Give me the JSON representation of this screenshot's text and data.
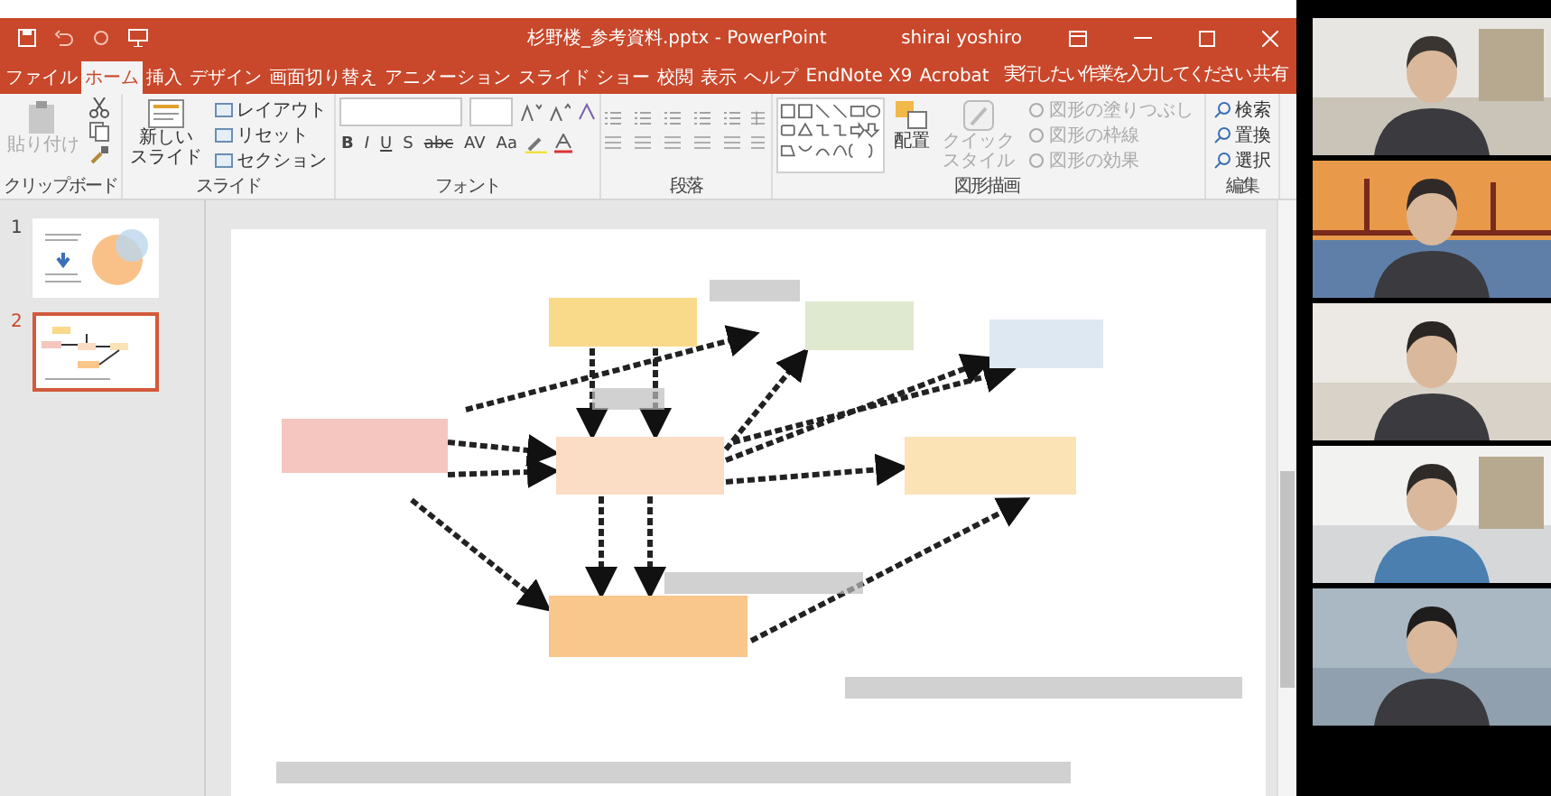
{
  "window": {
    "title": "杉野楼_参考資料.pptx  -  PowerPoint",
    "user": "shirai yoshiro"
  },
  "tabs": [
    {
      "label": "ファイル",
      "selected": false
    },
    {
      "label": "ホーム",
      "selected": true
    },
    {
      "label": "挿入",
      "selected": false
    },
    {
      "label": "デザイン",
      "selected": false
    },
    {
      "label": "画面切り替え",
      "selected": false
    },
    {
      "label": "アニメーション",
      "selected": false
    },
    {
      "label": "スライド ショー",
      "selected": false
    },
    {
      "label": "校閲",
      "selected": false
    },
    {
      "label": "表示",
      "selected": false
    },
    {
      "label": "ヘルプ",
      "selected": false
    },
    {
      "label": "EndNote X9",
      "selected": false
    },
    {
      "label": "Acrobat",
      "selected": false
    }
  ],
  "tell_me": "実行したい作業を入力してください",
  "share": "共有",
  "ribbon": {
    "clipboard": {
      "label": "クリップボード",
      "paste": "貼り付け"
    },
    "slides": {
      "label": "スライド",
      "new_slide": [
        "新しい",
        "スライド"
      ],
      "items": [
        "レイアウト",
        "リセット",
        "セクション"
      ]
    },
    "font": {
      "label": "フォント",
      "buttons": [
        "B",
        "I",
        "U",
        "S",
        "abc",
        "AV",
        "Aa"
      ]
    },
    "paragraph": {
      "label": "段落"
    },
    "drawing": {
      "label": "図形描画",
      "arrange": "配置",
      "quick_style": [
        "クイック",
        "スタイル"
      ],
      "items": [
        "図形の塗りつぶし",
        "図形の枠線",
        "図形の効果"
      ]
    },
    "editing": {
      "label": "編集",
      "items": [
        "検索",
        "置換",
        "選択"
      ]
    }
  },
  "thumbnails": [
    {
      "number": "1",
      "selected": false
    },
    {
      "number": "2",
      "selected": true
    }
  ],
  "slide": {
    "boxes": [
      {
        "color": "#f9d98a"
      },
      {
        "color": "#dfe9cf"
      },
      {
        "color": "#dde8f3"
      },
      {
        "color": "#f5c5bf"
      },
      {
        "color": "#fbdcc5"
      },
      {
        "color": "#fbe3b5"
      },
      {
        "color": "#f9c68c"
      }
    ]
  }
}
